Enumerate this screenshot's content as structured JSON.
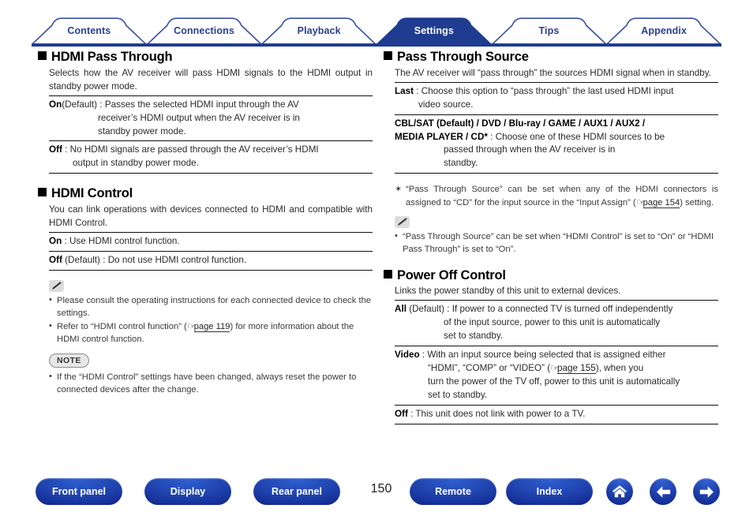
{
  "tabs": [
    {
      "label": "Contents",
      "active": false
    },
    {
      "label": "Connections",
      "active": false
    },
    {
      "label": "Playback",
      "active": false
    },
    {
      "label": "Settings",
      "active": true
    },
    {
      "label": "Tips",
      "active": false
    },
    {
      "label": "Appendix",
      "active": false
    }
  ],
  "colors": {
    "tab_border": "#3a4fa8",
    "tab_active_bg": "#1f3c91",
    "tab_text": "#2a3f96",
    "baseline": "#1f3c91",
    "button_blue": "#1f43ae"
  },
  "left_column": {
    "section1": {
      "heading": "HDMI Pass Through",
      "lead": "Selects how the AV receiver will pass HDMI signals to the HDMI output in standby power mode.",
      "defs": [
        {
          "term": "On",
          "qualifier": "(Default)",
          "sep": " : ",
          "line1": "Passes the selected HDMI input through the AV",
          "line2": "receiver’s HDMI output when the AV receiver is in",
          "line3": "standby power mode."
        },
        {
          "term": "Off",
          "qualifier": "",
          "sep": " : ",
          "line1": "No HDMI signals are passed through the AV receiver’s HDMI",
          "line2": "output in standby power mode.",
          "line3": ""
        }
      ]
    },
    "section2": {
      "heading": "HDMI Control",
      "lead": "You can link operations with devices connected to HDMI and compatible with HDMI Control.",
      "defs": [
        {
          "term": "On",
          "qualifier": "",
          "sep": " : ",
          "line1": "Use HDMI control function."
        },
        {
          "term": "Off",
          "qualifier": "(Default)",
          "sep": " : ",
          "line1": "Do not use HDMI control function."
        }
      ]
    },
    "tip_icon": "pencil-icon",
    "tips": [
      {
        "text_before": "Please consult the operating instructions for each connected device to check the settings.",
        "link": null,
        "text_after": ""
      },
      {
        "text_before": "Refer to “HDMI control function” (",
        "link": "page 119",
        "text_after": ") for more information about the HDMI control function."
      }
    ],
    "note_label": "NOTE",
    "notes": [
      "If the “HDMI Control” settings have been changed, always reset the power to connected devices after the change."
    ]
  },
  "right_column": {
    "section1": {
      "heading": "Pass Through Source",
      "lead": "The AV receiver will “pass through” the sources HDMI signal when in standby.",
      "defs": [
        {
          "term": "Last",
          "qualifier": "",
          "sep": " : ",
          "line1": "Choose this option to “pass through” the last used HDMI input",
          "line2": "video source."
        }
      ],
      "source_list": {
        "row1": "CBL/SAT (Default) / DVD / Blu-ray / GAME / AUX1 / AUX2 /",
        "row2_terms": "MEDIA PLAYER / CD*",
        "row2_sep": " : ",
        "row2_line1": "Choose one of these HDMI sources to be",
        "row2_line2": "passed through when the AV receiver is in",
        "row2_line3": "standby.",
        "terms": [
          "CBL/SAT",
          "DVD",
          "Blu-ray",
          "GAME",
          "AUX1",
          "AUX2",
          "MEDIA PLAYER",
          "CD"
        ],
        "default": "CBL/SAT"
      }
    },
    "asterisk_note": {
      "marker": "✶",
      "text_before": "“Pass Through Source” can be set when any of the HDMI connectors is assigned to “CD” for the input source in the “Input Assign” (",
      "link": "page 154",
      "text_after": ") setting."
    },
    "tip_icon": "pencil-icon",
    "tips": [
      "“Pass Through Source” can be set when “HDMI Control” is set to “On” or “HDMI Pass Through” is set to “On”."
    ],
    "section2": {
      "heading": "Power Off Control",
      "lead": "Links the power standby of this unit to external devices.",
      "defs": [
        {
          "term": "All",
          "qualifier": "(Default)",
          "sep": " : ",
          "line1": "If power to a connected TV is turned off independently",
          "line2": "of the input source, power to this unit is automatically",
          "line3": "set to standby."
        },
        {
          "term": "Video",
          "qualifier": "",
          "sep": " : ",
          "line1": "With an input source being selected that is assigned either",
          "line2_a": "“HDMI”, “COMP” or “VIDEO” (",
          "line2_link": "page 155",
          "line2_b": "), when you",
          "line3": "turn the power of the TV off, power to this unit is automatically",
          "line4": "set to standby."
        },
        {
          "term": "Off",
          "qualifier": "",
          "sep": " : ",
          "line1": "This unit does not link with power to a TV."
        }
      ]
    }
  },
  "footer": {
    "buttons": [
      {
        "label": "Front panel",
        "name": "front-panel-button"
      },
      {
        "label": "Display",
        "name": "display-button"
      },
      {
        "label": "Rear panel",
        "name": "rear-panel-button"
      },
      {
        "label": "Remote",
        "name": "remote-button"
      },
      {
        "label": "Index",
        "name": "index-button"
      }
    ],
    "page_number": "150",
    "icons": [
      "home-icon",
      "arrow-left-icon",
      "arrow-right-icon"
    ]
  }
}
